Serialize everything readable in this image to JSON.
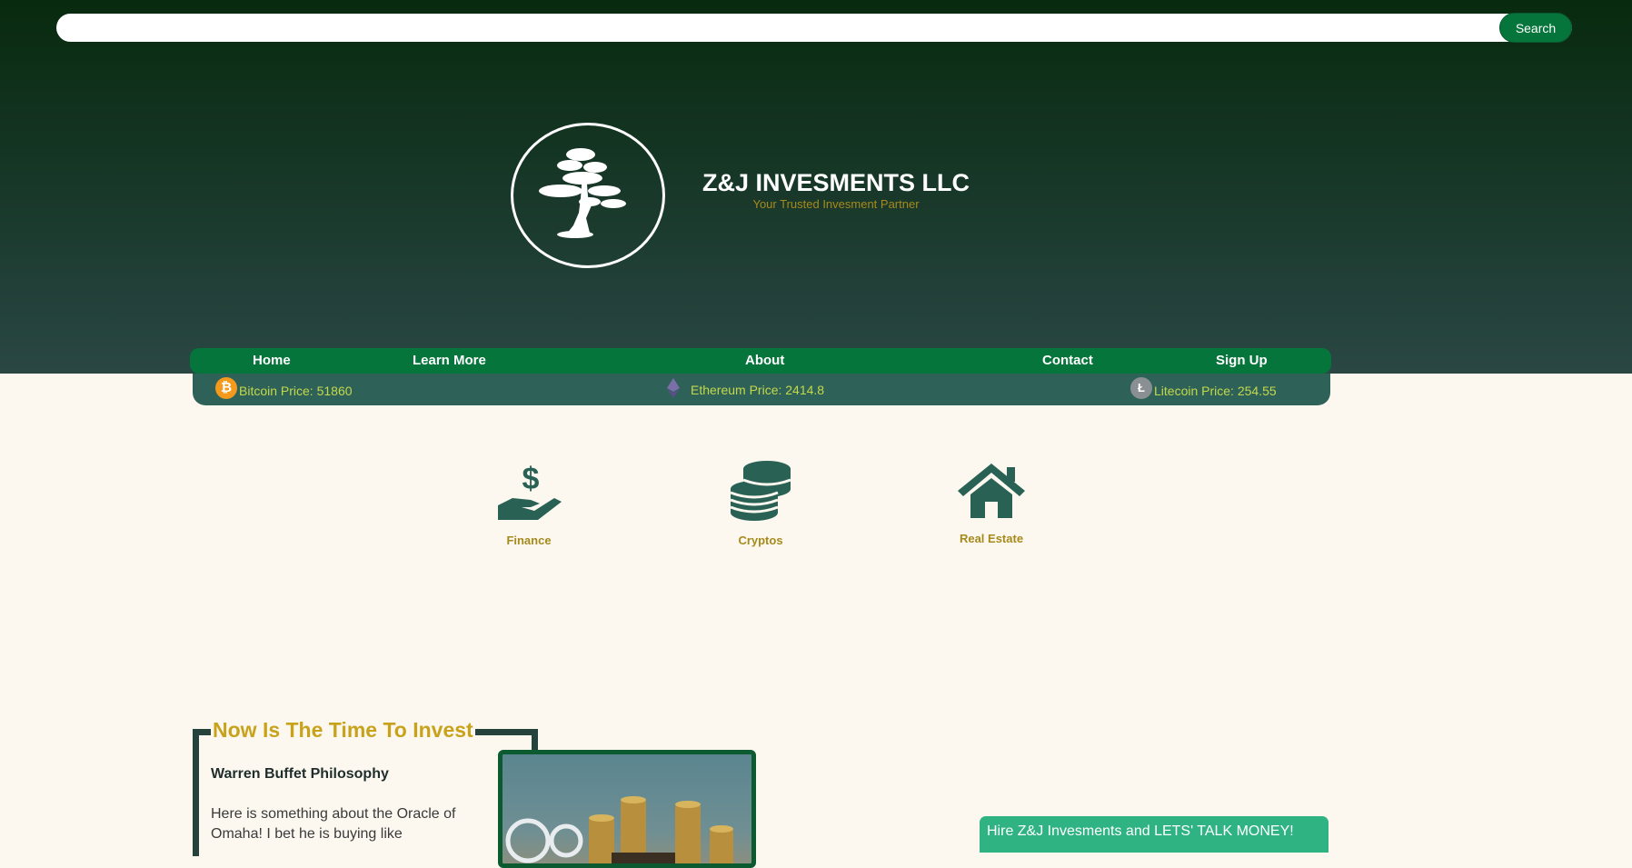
{
  "search": {
    "placeholder": "",
    "button_label": "Search"
  },
  "brand": {
    "name": "Z&J INVESMENTS LLC",
    "tagline": "Your Trusted Invesment Partner"
  },
  "nav": {
    "items": [
      "Home",
      "Learn More",
      "About",
      "Contact",
      "Sign Up"
    ]
  },
  "ticker": {
    "bitcoin": "Bitcoin Price: 51860",
    "ethereum": "Ethereum Price: 2414.8",
    "litecoin": "Litecoin Price: 254.55"
  },
  "features": {
    "finance": "Finance",
    "cryptos": "Cryptos",
    "real_estate": "Real Estate"
  },
  "section": {
    "title": "Now Is The Time To Invest",
    "subtitle": "Warren Buffet Philosophy",
    "body": "Here is something about the Oracle of Omaha! I bet he is buying like"
  },
  "cta": {
    "label": "Hire Z&J Invesments and LETS' TALK MONEY!"
  },
  "colors": {
    "accent_green": "#05753b",
    "gold": "#a68a1b",
    "teal": "#2e6258",
    "cta": "#2fb383"
  },
  "icons": [
    "logo-tree-icon",
    "bitcoin-icon",
    "ethereum-icon",
    "litecoin-icon",
    "finance-hand-dollar-icon",
    "cryptos-coins-icon",
    "real-estate-house-icon"
  ]
}
